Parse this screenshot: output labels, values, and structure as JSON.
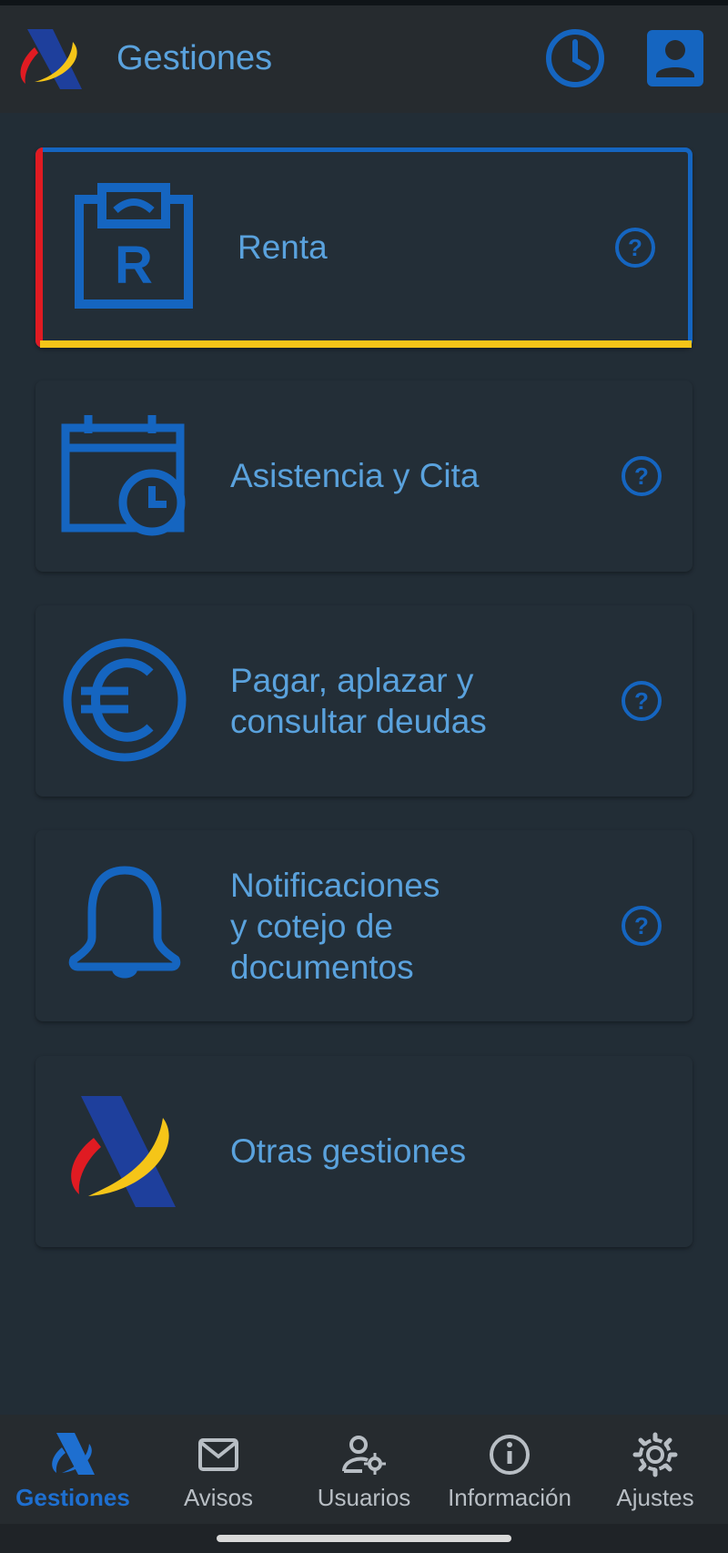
{
  "appbar": {
    "title": "Gestiones",
    "icons": {
      "logo": "aeat-logo",
      "history": "clock-icon",
      "account": "account-icon"
    }
  },
  "cards": [
    {
      "label": "Renta",
      "icon": "renta-icon",
      "help": "help-icon",
      "selected": true
    },
    {
      "label": "Asistencia y Cita",
      "icon": "calendar-clock-icon",
      "help": "help-icon"
    },
    {
      "label_lines": [
        "Pagar, aplazar y",
        "consultar deudas"
      ],
      "icon": "euro-icon",
      "help": "help-icon"
    },
    {
      "label_lines": [
        "Notificaciones",
        "y cotejo de",
        "documentos"
      ],
      "icon": "bell-icon",
      "help": "help-icon"
    },
    {
      "label": "Otras gestiones",
      "icon": "aeat-logo"
    }
  ],
  "bottom_nav": [
    {
      "label": "Gestiones",
      "icon": "aeat-logo",
      "active": true
    },
    {
      "label": "Avisos",
      "icon": "mail-icon"
    },
    {
      "label": "Usuarios",
      "icon": "user-settings-icon"
    },
    {
      "label": "Información",
      "icon": "info-icon"
    },
    {
      "label": "Ajustes",
      "icon": "gear-icon"
    }
  ],
  "colors": {
    "accent": "#1565c0",
    "text_accent": "#5aa2dd",
    "background": "#222d36",
    "appbar": "#262b2f",
    "red": "#e01b22",
    "yellow": "#f5c518",
    "logo_blue": "#1e3f9c"
  }
}
